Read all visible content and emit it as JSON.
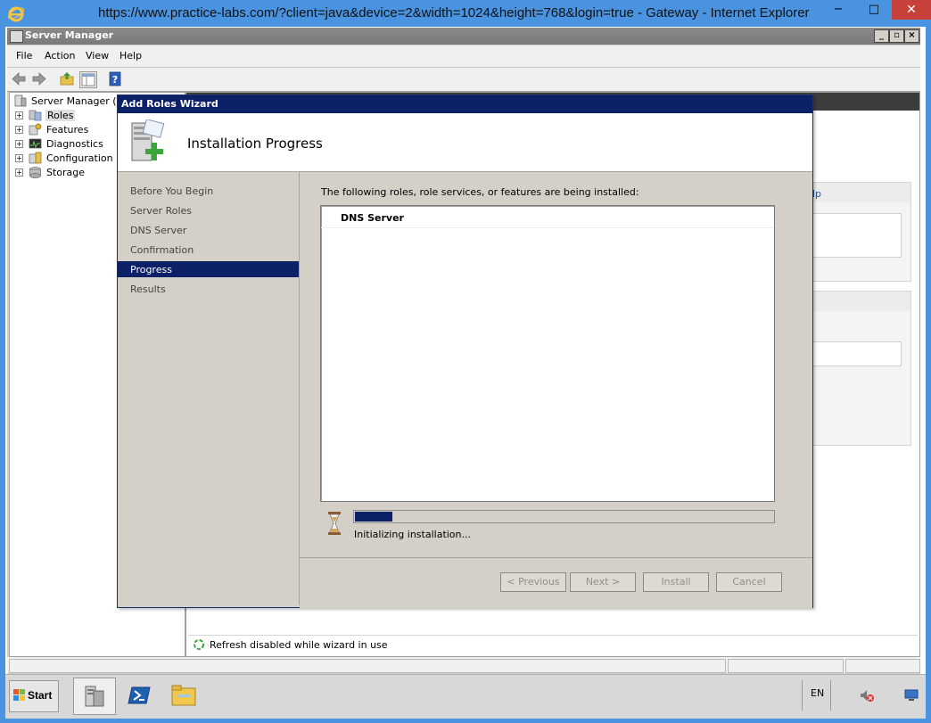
{
  "ie": {
    "title": "https://www.practice-labs.com/?client=java&device=2&width=1024&height=768&login=true - Gateway  - Internet Explorer",
    "minimize": "−",
    "restore": "□",
    "close": "✕"
  },
  "server_manager": {
    "title": "Server Manager",
    "menu": [
      "File",
      "Action",
      "View",
      "Help"
    ],
    "tree": {
      "root": "Server Manager (PL",
      "items": [
        "Roles",
        "Features",
        "Diagnostics",
        "Configuration",
        "Storage"
      ]
    },
    "right_pane_fragment": "lp",
    "refresh_status": "Refresh disabled while wizard in use"
  },
  "wizard": {
    "title": "Add Roles Wizard",
    "heading": "Installation Progress",
    "steps": [
      "Before You Begin",
      "Server Roles",
      "DNS Server",
      "Confirmation",
      "Progress",
      "Results"
    ],
    "active_step": "Progress",
    "intro": "The following roles, role services, or features are being installed:",
    "items": [
      "DNS Server"
    ],
    "progress": 0.09,
    "progress_label": "Initializing installation...",
    "buttons": {
      "previous": "< Previous",
      "next": "Next >",
      "install": "Install",
      "cancel": "Cancel"
    }
  },
  "taskbar": {
    "start": "Start",
    "language": "EN"
  }
}
